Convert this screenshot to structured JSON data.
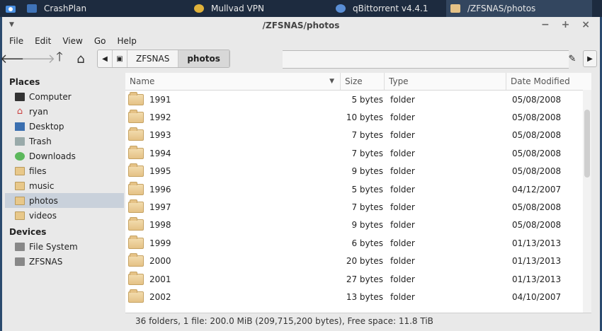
{
  "taskbar": {
    "items": [
      {
        "label": "CrashPlan",
        "icon": "crashplan-icon"
      },
      {
        "label": "Mullvad VPN",
        "icon": "mullvad-icon"
      },
      {
        "label": "qBittorrent v4.4.1",
        "icon": "qbittorrent-icon"
      },
      {
        "label": "/ZFSNAS/photos",
        "icon": "folder-icon"
      }
    ]
  },
  "window": {
    "title": "/ZFSNAS/photos",
    "controls": "− + ×"
  },
  "menu": [
    "File",
    "Edit",
    "View",
    "Go",
    "Help"
  ],
  "path": {
    "segments": [
      "ZFSNAS",
      "photos"
    ]
  },
  "sidebar": {
    "places_heading": "Places",
    "places": [
      "Computer",
      "ryan",
      "Desktop",
      "Trash",
      "Downloads",
      "files",
      "music",
      "photos",
      "videos"
    ],
    "devices_heading": "Devices",
    "devices": [
      "File System",
      "ZFSNAS"
    ]
  },
  "columns": {
    "name": "Name",
    "size": "Size",
    "type": "Type",
    "date": "Date Modified"
  },
  "rows": [
    {
      "name": "1991",
      "size": "5 bytes",
      "type": "folder",
      "date": "05/08/2008"
    },
    {
      "name": "1992",
      "size": "10 bytes",
      "type": "folder",
      "date": "05/08/2008"
    },
    {
      "name": "1993",
      "size": "7 bytes",
      "type": "folder",
      "date": "05/08/2008"
    },
    {
      "name": "1994",
      "size": "7 bytes",
      "type": "folder",
      "date": "05/08/2008"
    },
    {
      "name": "1995",
      "size": "9 bytes",
      "type": "folder",
      "date": "05/08/2008"
    },
    {
      "name": "1996",
      "size": "5 bytes",
      "type": "folder",
      "date": "04/12/2007"
    },
    {
      "name": "1997",
      "size": "7 bytes",
      "type": "folder",
      "date": "05/08/2008"
    },
    {
      "name": "1998",
      "size": "9 bytes",
      "type": "folder",
      "date": "05/08/2008"
    },
    {
      "name": "1999",
      "size": "6 bytes",
      "type": "folder",
      "date": "01/13/2013"
    },
    {
      "name": "2000",
      "size": "20 bytes",
      "type": "folder",
      "date": "01/13/2013"
    },
    {
      "name": "2001",
      "size": "27 bytes",
      "type": "folder",
      "date": "01/13/2013"
    },
    {
      "name": "2002",
      "size": "13 bytes",
      "type": "folder",
      "date": "04/10/2007"
    }
  ],
  "status": "36 folders, 1 file: 200.0 MiB (209,715,200 bytes), Free space: 11.8 TiB"
}
